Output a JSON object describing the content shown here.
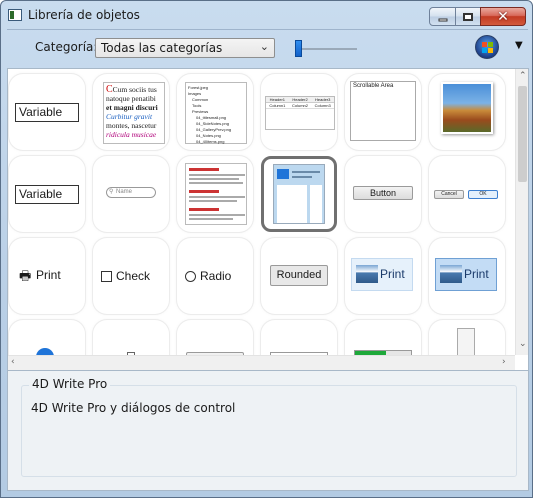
{
  "window": {
    "title": "Librería de objetos",
    "caption": {
      "minimize": "minimize-icon",
      "maximize": "maximize-icon",
      "close": "close-icon"
    }
  },
  "toolbar": {
    "category_label": "Categoría:",
    "category_value": "Todas las categorías"
  },
  "grid": {
    "tiles": {
      "r0c0": {
        "label": "Variable"
      },
      "r0c1": {
        "lines": [
          "Cum sociis tus",
          "natoque penatibi",
          "et magni discuri",
          "Curbitur gravit",
          "montes, nascetur",
          "ridicula musicae"
        ]
      },
      "r0c2": {
        "files": [
          "Forest.jpeg",
          "Images",
          "Common",
          "Tools",
          "Previews",
          "04_titlesmall.png",
          "04_SideNotes.png",
          "04_GalleryPrev.png",
          "04_Notes.png",
          "04_40items.png"
        ]
      },
      "r0c3": {
        "headers": [
          "Header1",
          "Header2",
          "Header3"
        ],
        "row": [
          "Column1",
          "Column2",
          "Column3"
        ]
      },
      "r0c4": {
        "label": "Scrollable Area"
      },
      "r1c0": {
        "label": "Variable"
      },
      "r1c1": {
        "placeholder": "Name"
      },
      "r1c4": {
        "label": "Button"
      },
      "r1c5": {
        "cancel": "Cancel",
        "ok": "OK"
      },
      "r2c0": {
        "label": "Print"
      },
      "r2c1": {
        "label": "Check"
      },
      "r2c2": {
        "label": "Radio"
      },
      "r2c3": {
        "label": "Rounded"
      },
      "r2c4": {
        "label": "Print"
      },
      "r2c5": {
        "label": "Print"
      }
    }
  },
  "info": {
    "title": "4D Write Pro",
    "description": "4D Write Pro y diálogos de control"
  },
  "colors": {
    "accent_blue": "#1f74d8",
    "progress_green": "#1ea83a",
    "selected_border": "#707070"
  }
}
